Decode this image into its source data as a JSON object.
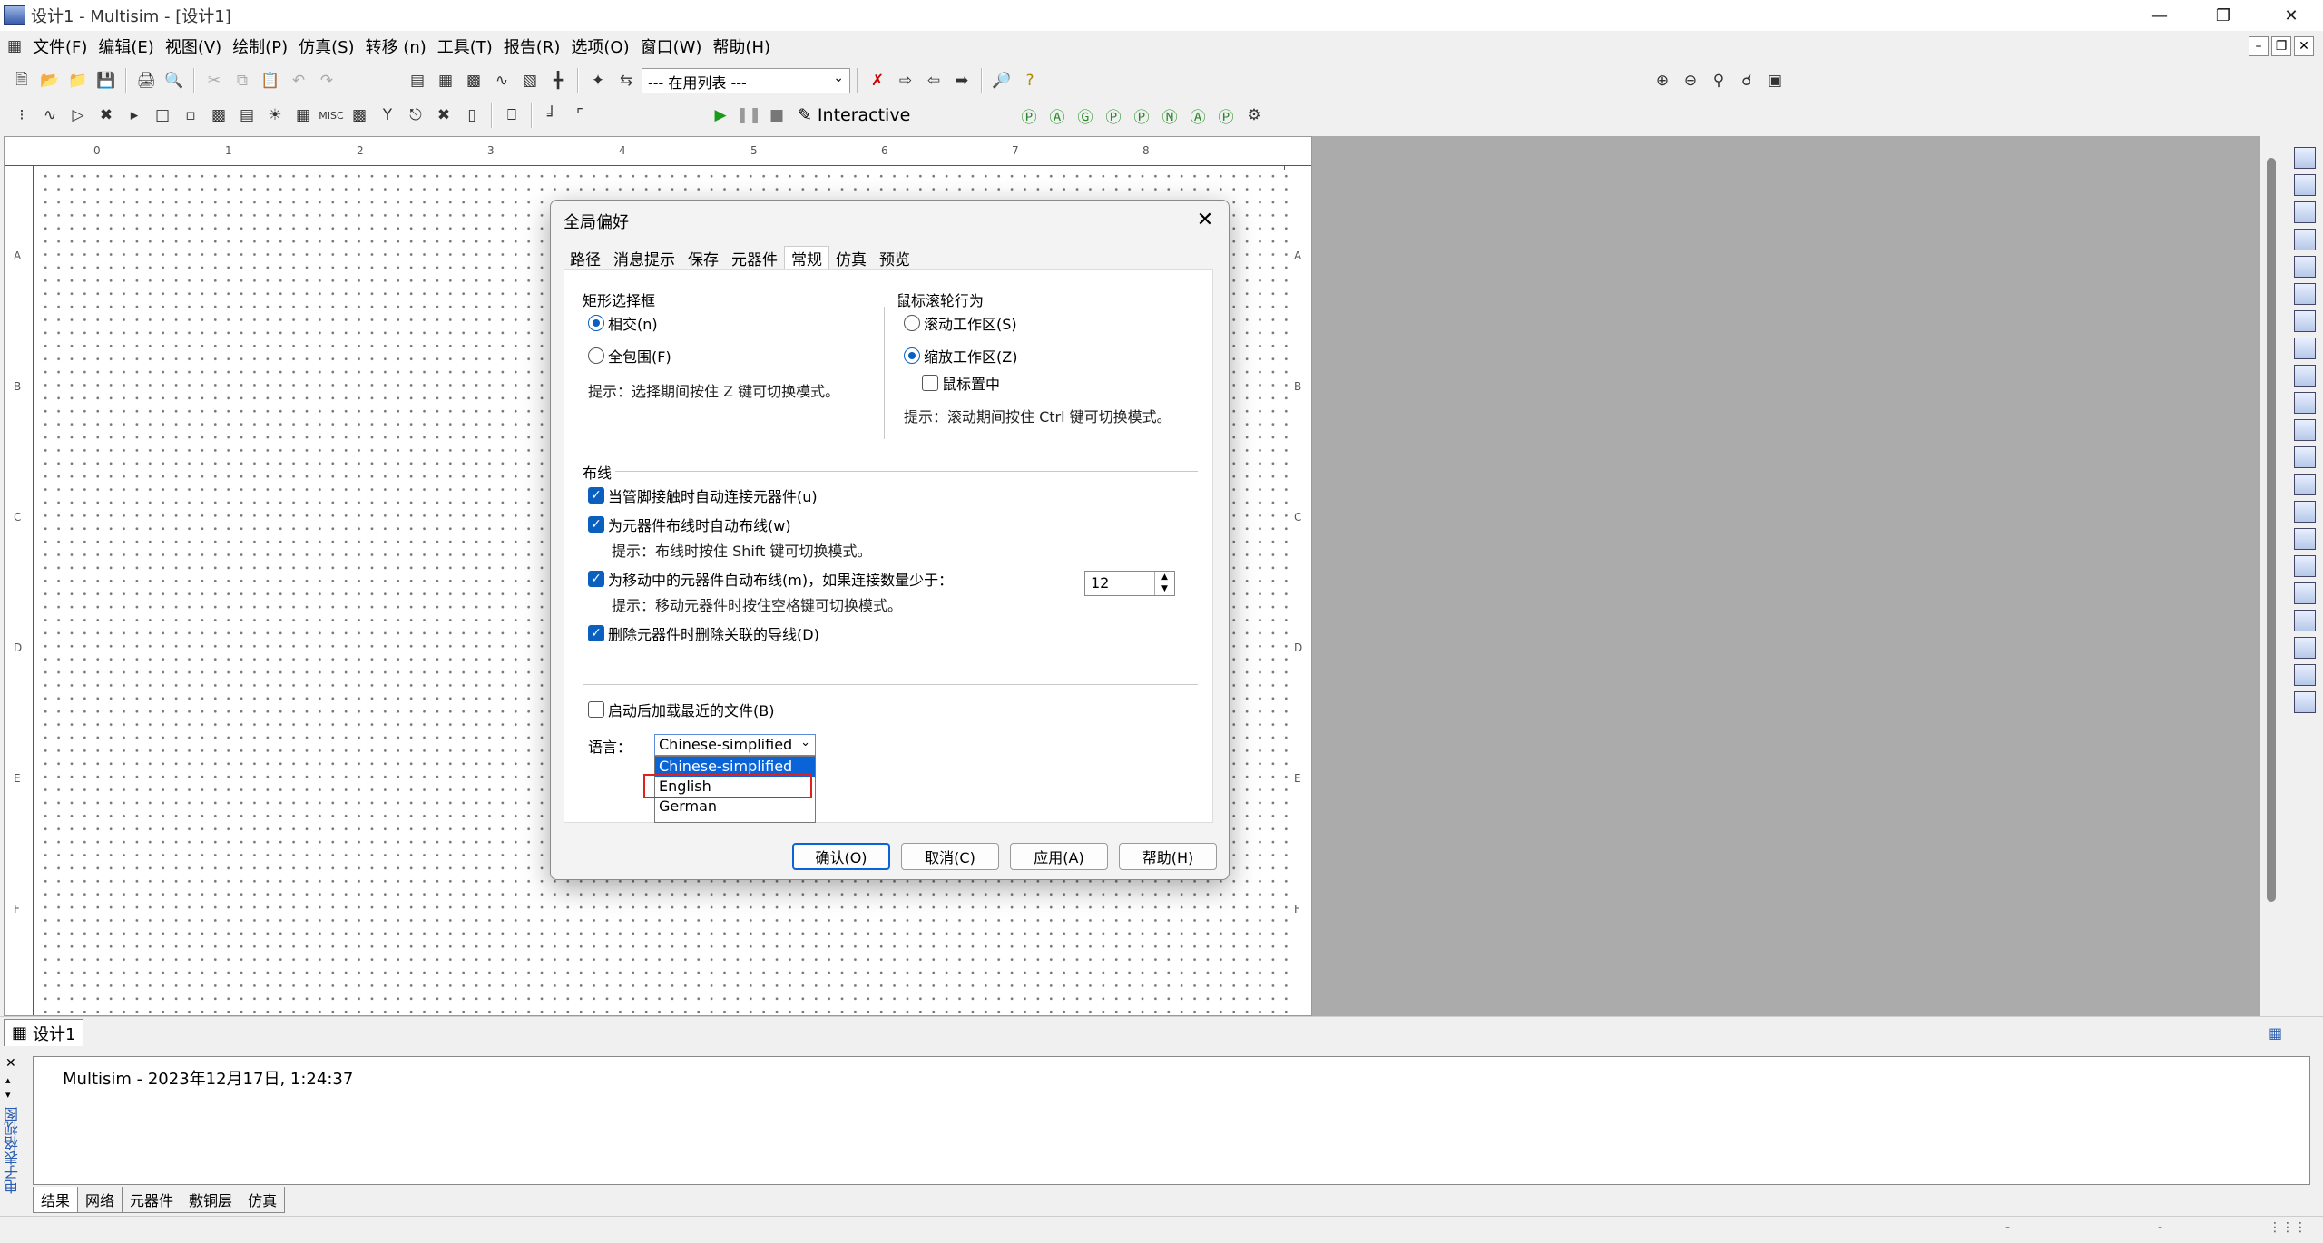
{
  "window": {
    "title": "设计1 - Multisim - [设计1]"
  },
  "menubar": {
    "items": [
      "文件(F)",
      "编辑(E)",
      "视图(V)",
      "绘制(P)",
      "仿真(S)",
      "转移 (n)",
      "工具(T)",
      "报告(R)",
      "选项(O)",
      "窗口(W)",
      "帮助(H)"
    ]
  },
  "toolbar": {
    "in_use_list": "--- 在用列表 ---",
    "interactive_label": "Interactive"
  },
  "ruler": {
    "top": [
      "0",
      "1",
      "2",
      "3",
      "4",
      "5",
      "6",
      "7",
      "8"
    ],
    "left": [
      "A",
      "B",
      "C",
      "D",
      "E",
      "F"
    ]
  },
  "design_tab": {
    "label": "设计1"
  },
  "output": {
    "vertical_label": "电子表格视图",
    "message": "Multisim  -  2023年12月17日, 1:24:37",
    "tabs": [
      "结果",
      "网络",
      "元器件",
      "敷铜层",
      "仿真"
    ]
  },
  "dialog": {
    "title": "全局偏好",
    "tabs": [
      "路径",
      "消息提示",
      "保存",
      "元器件",
      "常规",
      "仿真",
      "预览"
    ],
    "active_tab": "常规",
    "rect_group": {
      "title": "矩形选择框",
      "opt1": "相交(n)",
      "opt2": "全包围(F)",
      "selected": "相交(n)",
      "hint": "提示：选择期间按住 Z 键可切换模式。"
    },
    "wheel_group": {
      "title": "鼠标滚轮行为",
      "opt1": "滚动工作区(S)",
      "opt2": "缩放工作区(Z)",
      "selected": "缩放工作区(Z)",
      "center_cb": "鼠标置中",
      "center_checked": false,
      "hint": "提示：滚动期间按住 Ctrl 键可切换模式。"
    },
    "wiring": {
      "title": "布线",
      "cb1": "当管脚接触时自动连接元器件(u)",
      "cb2": "为元器件布线时自动布线(w)",
      "hint2": "提示：布线时按住 Shift 键可切换模式。",
      "cb3": "为移动中的元器件自动布线(m)，如果连接数量少于：",
      "count": "12",
      "hint3": "提示：移动元器件时按住空格键可切换模式。",
      "cb4": "删除元器件时删除关联的导线(D)"
    },
    "startup_cb": "启动后加载最近的文件(B)",
    "language": {
      "label": "语言：",
      "selected": "Chinese-simplified",
      "options": [
        "Chinese-simplified",
        "English",
        "German"
      ],
      "highlighted": "English"
    },
    "buttons": {
      "ok": "确认(O)",
      "cancel": "取消(C)",
      "apply": "应用(A)",
      "help": "帮助(H)"
    }
  }
}
